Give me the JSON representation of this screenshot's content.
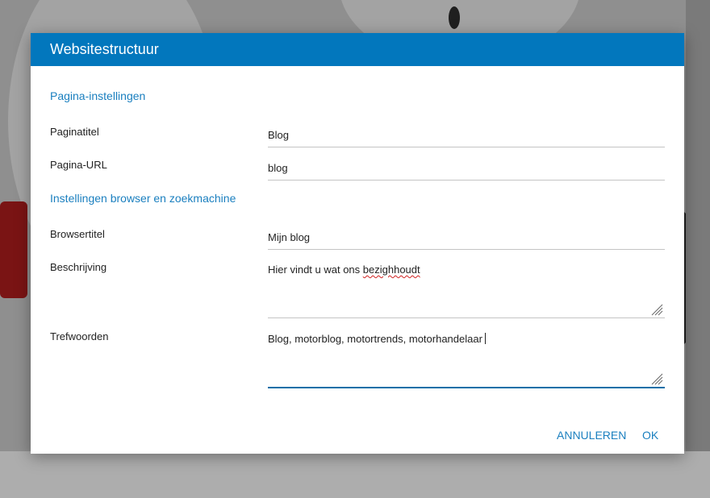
{
  "dialog": {
    "title": "Websitestructuur"
  },
  "sections": {
    "page_settings": "Pagina-instellingen",
    "browser_settings": "Instellingen browser en zoekmachine"
  },
  "fields": {
    "page_title": {
      "label": "Paginatitel",
      "value": "Blog"
    },
    "page_url": {
      "label": "Pagina-URL",
      "value": "blog"
    },
    "browser_title": {
      "label": "Browsertitel",
      "value": "Mijn blog"
    },
    "description": {
      "label": "Beschrijving",
      "value_prefix": "Hier vindt u wat ons ",
      "value_misspelled": "bezighhoudt"
    },
    "keywords": {
      "label": "Trefwoorden",
      "value": "Blog, motorblog, motortrends, motorhandelaar"
    }
  },
  "buttons": {
    "cancel": "ANNULEREN",
    "ok": "OK"
  },
  "colors": {
    "header": "#0277bd",
    "accent": "#1a7fbf",
    "spellcheck": "#d02020"
  }
}
